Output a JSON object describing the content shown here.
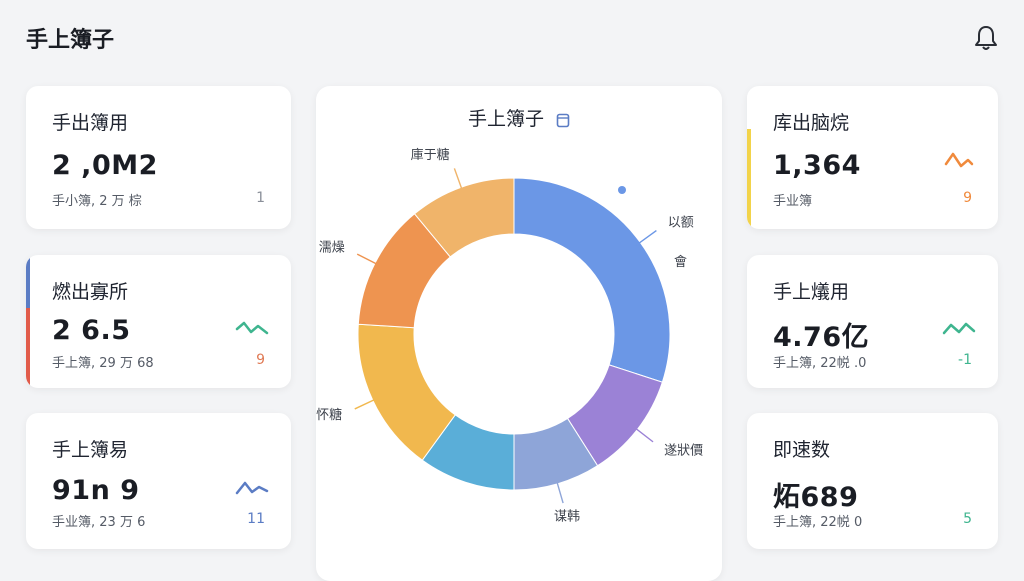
{
  "app": {
    "title": "手上簿子"
  },
  "cards_left": [
    {
      "title": "手出簿用",
      "value": "2 ,0M2",
      "sub": "手小簿, 2 万 棕",
      "delta": "1",
      "accent": "",
      "trend_color": "#8a8f99",
      "icon": ""
    },
    {
      "title": "燃出寡所",
      "value": "2 6.5",
      "sub": "手上簿, 29 万 68",
      "delta": "9",
      "accent": "#e15b4a",
      "trend_color": "#e07a55",
      "icon": "trend-icon"
    },
    {
      "title": "手上簿易",
      "value": "91n 9",
      "sub": "手业簿, 23 万 6",
      "delta": "11",
      "accent": "",
      "trend_color": "#5b7cc4",
      "icon": "trend-icon"
    }
  ],
  "cards_right": [
    {
      "title": "库出脑烷",
      "value": "1,364",
      "sub": "手业簿",
      "delta": "9",
      "accent": "#f2d34a",
      "trend_color": "#f08a3c",
      "icon": "trend-icon"
    },
    {
      "title": "手上燨用",
      "value": "4.76亿",
      "sub": "手上簿, 22帨 .0",
      "delta": "-1",
      "accent": "",
      "trend_color": "#3fb58f",
      "icon": "trend-icon"
    },
    {
      "title": "即速数",
      "value": "炻689",
      "sub": "手上簿, 22帨 0",
      "delta": "5",
      "accent": "",
      "trend_color": "#3fb58f",
      "icon": ""
    }
  ],
  "donut": {
    "title": "手上簿子",
    "segments": [
      {
        "label": "以额",
        "value": 30,
        "color": "#6b97e6"
      },
      {
        "label": "遂狀價",
        "value": 11,
        "color": "#9b82d6"
      },
      {
        "label": "谋韩",
        "value": 9,
        "color": "#8ea5d8"
      },
      {
        "label": "",
        "value": 10,
        "color": "#5aaed8"
      },
      {
        "label": "怀糖",
        "value": 16,
        "color": "#f1b84e"
      },
      {
        "label": "濡燥",
        "value": 13,
        "color": "#ee9450"
      },
      {
        "label": "庫于糖",
        "value": 11,
        "color": "#f0b46a"
      }
    ],
    "extra_label": "會"
  }
}
